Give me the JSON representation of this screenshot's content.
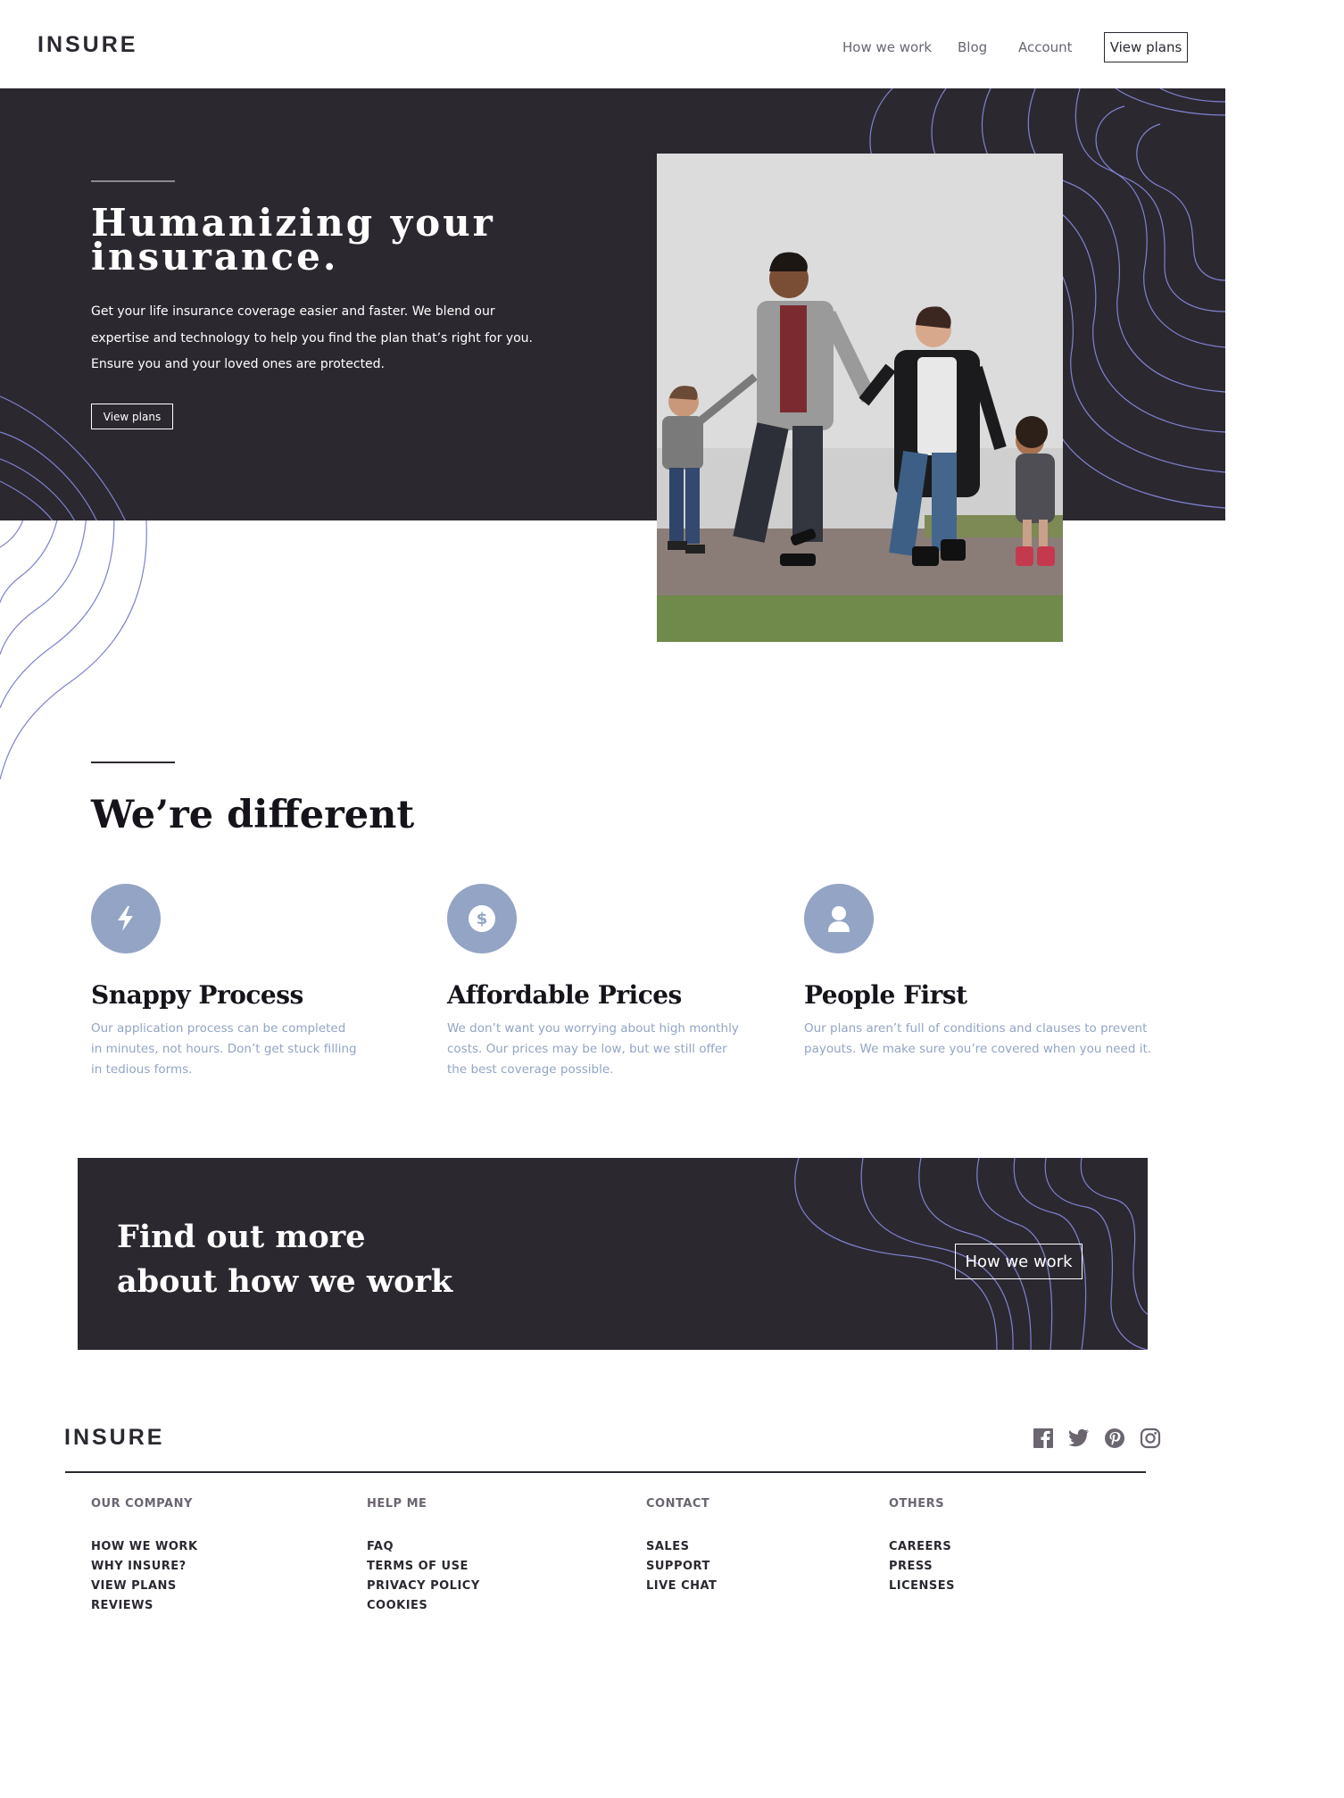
{
  "header": {
    "logo": "INSURE",
    "nav": [
      "How we work",
      "Blog",
      "Account"
    ],
    "cta": "View plans"
  },
  "hero": {
    "title_line1": "Humanizing your",
    "title_line2": "insurance.",
    "text": "Get your life insurance coverage easier and faster. We blend our expertise and technology to help you find the plan that’s right for you. Ensure you and your loved ones are protected.",
    "button": "View plans"
  },
  "different": {
    "title": "We’re different",
    "features": [
      {
        "icon": "lightning-icon",
        "title": "Snappy Process",
        "text": "Our application process can be completed in minutes, not hours. Don’t get stuck filling in tedious forms."
      },
      {
        "icon": "dollar-coin-icon",
        "title": "Affordable Prices",
        "text": "We don’t want you worrying about high monthly costs. Our prices may be low, but we still offer the best coverage possible."
      },
      {
        "icon": "person-icon",
        "title": "People First",
        "text": "Our plans aren’t full of conditions and clauses to prevent payouts. We make sure you’re covered when you need it."
      }
    ]
  },
  "cta": {
    "title_line1": "Find out more",
    "title_line2": "about how we work",
    "button": "How we work"
  },
  "footer": {
    "logo": "INSURE",
    "social": [
      "facebook-icon",
      "twitter-icon",
      "pinterest-icon",
      "instagram-icon"
    ],
    "columns": [
      {
        "heading": "OUR COMPANY",
        "links": [
          "HOW WE WORK",
          "WHY INSURE?",
          "VIEW PLANS",
          "REVIEWS"
        ]
      },
      {
        "heading": "HELP ME",
        "links": [
          "FAQ",
          "TERMS OF USE",
          "PRIVACY POLICY",
          "COOKIES"
        ]
      },
      {
        "heading": "CONTACT",
        "links": [
          "SALES",
          "SUPPORT",
          "LIVE CHAT"
        ]
      },
      {
        "heading": "OTHERS",
        "links": [
          "CAREERS",
          "PRESS",
          "LICENSES"
        ]
      }
    ]
  },
  "colors": {
    "dark": "#2c2830",
    "accent": "#93a4c4",
    "contour": "#7f82d0"
  }
}
